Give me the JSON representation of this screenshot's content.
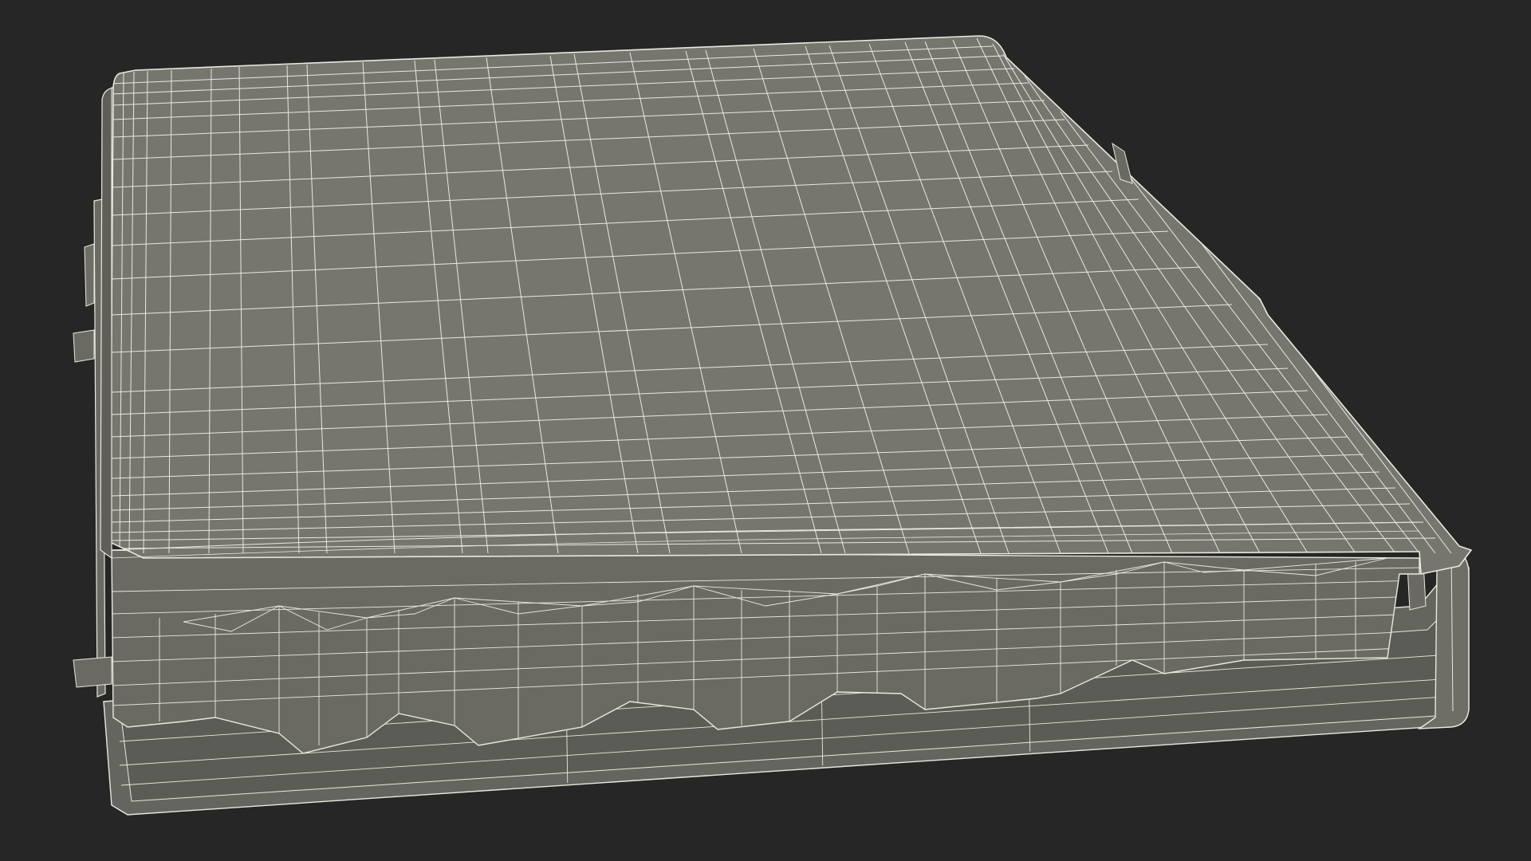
{
  "scene": {
    "subject": "mattress-wireframe-render",
    "render_style": "wireframe-on-shaded",
    "colors": {
      "background": "#262626",
      "surface_top": "#75756d",
      "surface_side": "#6c6c64",
      "surface_dark": "#5f5f58",
      "wire": "#e9e9df",
      "frame": "#6a6a63"
    }
  }
}
